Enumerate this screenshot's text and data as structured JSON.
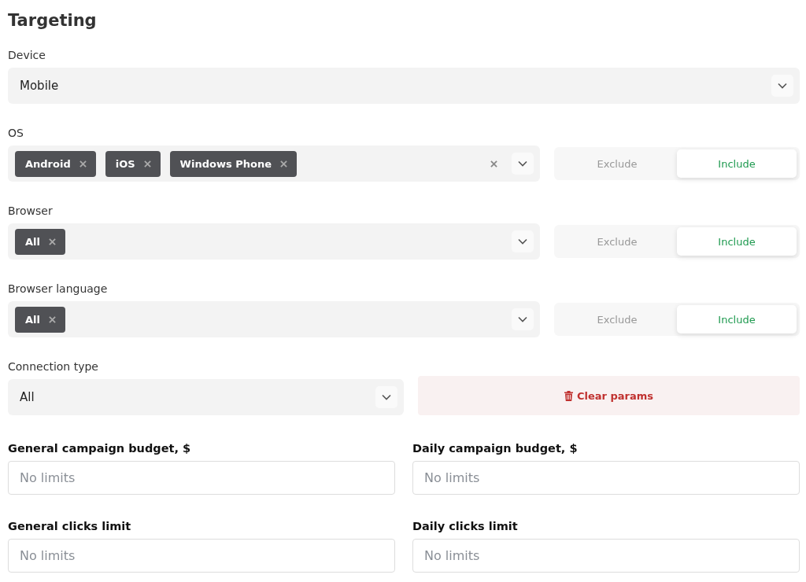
{
  "title": "Targeting",
  "device": {
    "label": "Device",
    "value": "Mobile"
  },
  "filters": [
    {
      "label": "OS",
      "tags": [
        "Android",
        "iOS",
        "Windows Phone"
      ],
      "clearable": true,
      "modes": [
        {
          "label": "Exclude",
          "selected": false
        },
        {
          "label": "Include",
          "selected": true
        }
      ]
    },
    {
      "label": "Browser",
      "tags": [
        "All"
      ],
      "clearable": false,
      "modes": [
        {
          "label": "Exclude",
          "selected": false
        },
        {
          "label": "Include",
          "selected": true
        }
      ]
    },
    {
      "label": "Browser language",
      "tags": [
        "All"
      ],
      "clearable": false,
      "modes": [
        {
          "label": "Exclude",
          "selected": false
        },
        {
          "label": "Include",
          "selected": true
        }
      ]
    }
  ],
  "connection": {
    "label": "Connection type",
    "value": "All"
  },
  "clear_button": {
    "label": "Clear params"
  },
  "limits": [
    {
      "label": "General campaign budget, $",
      "placeholder": "No limits"
    },
    {
      "label": "Daily campaign budget, $",
      "placeholder": "No limits"
    },
    {
      "label": "General clicks limit",
      "placeholder": "No limits"
    },
    {
      "label": "Daily clicks limit",
      "placeholder": "No limits"
    }
  ]
}
